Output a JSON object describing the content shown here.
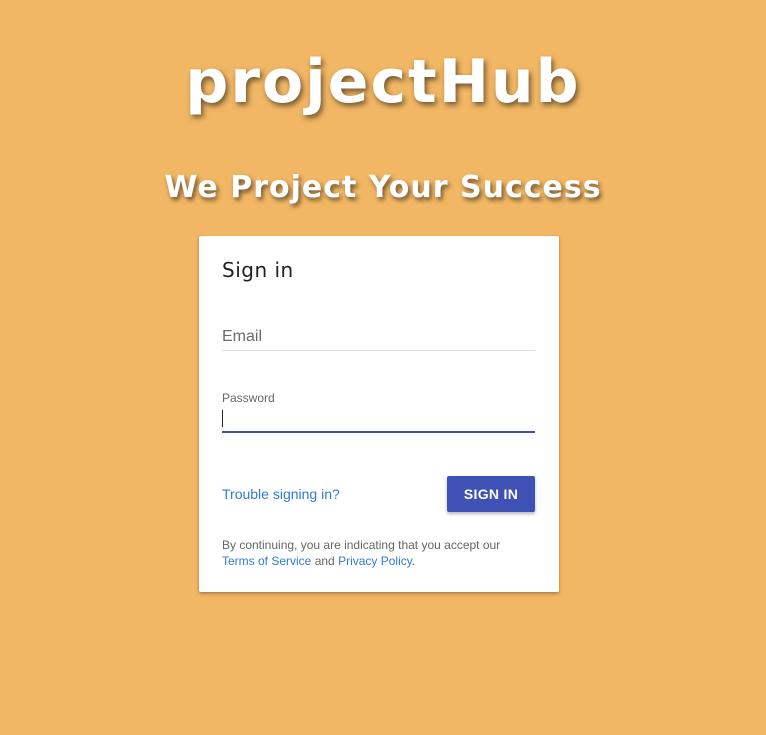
{
  "brand": {
    "title": "projectHub",
    "tagline": "We Project Your Success"
  },
  "signin": {
    "heading": "Sign in",
    "email_label": "Email",
    "password_label": "Password",
    "password_value": "",
    "trouble_link": "Trouble signing in?",
    "submit_label": "SIGN IN",
    "legal_prefix": "By continuing, you are indicating that you accept our",
    "terms_link": "Terms of Service",
    "legal_and": "and",
    "privacy_link": "Privacy Policy",
    "legal_suffix": "."
  },
  "colors": {
    "background": "#F2B764",
    "accent": "#3F51B5",
    "link": "#2F7CD6",
    "card": "#FFFFFF"
  }
}
